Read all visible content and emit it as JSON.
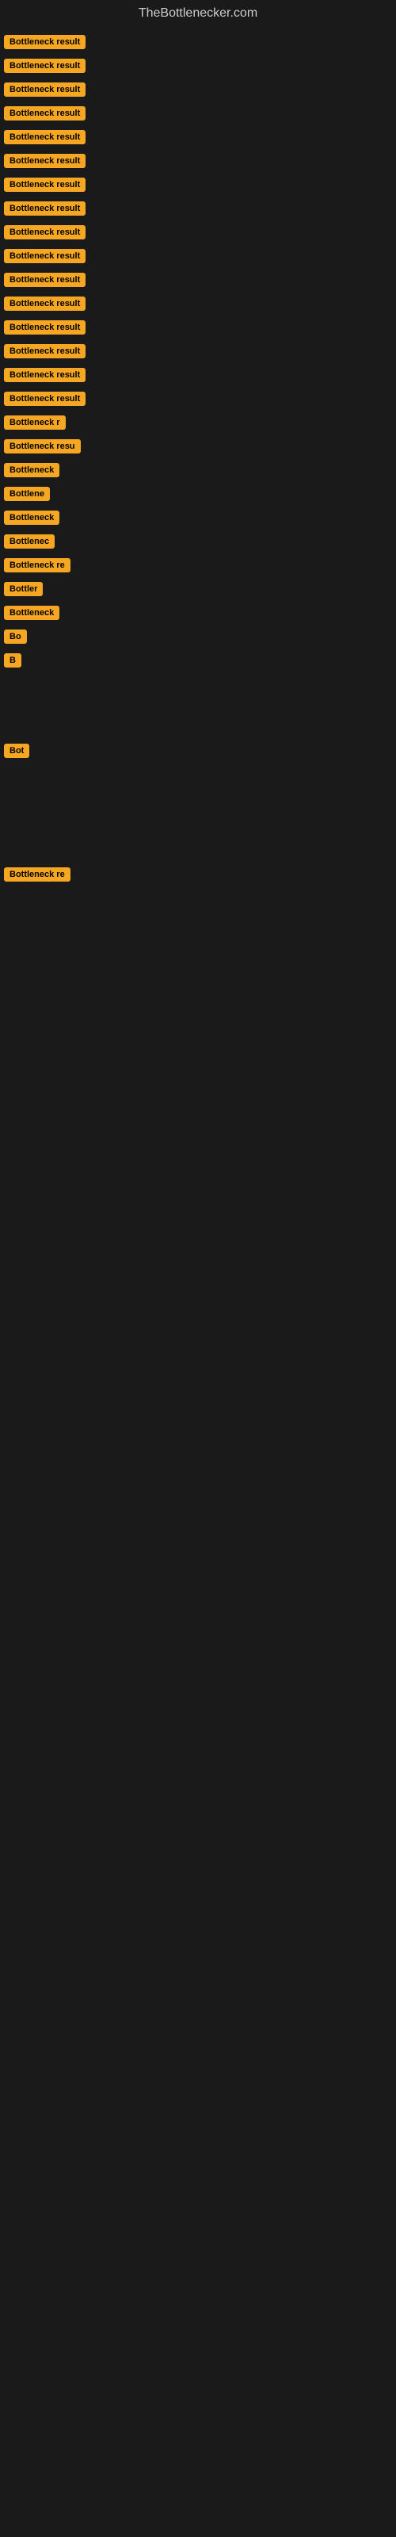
{
  "site": {
    "title": "TheBottlenecker.com"
  },
  "items": [
    {
      "id": 1,
      "label": "Bottleneck result",
      "width": 130
    },
    {
      "id": 2,
      "label": "Bottleneck result",
      "width": 130
    },
    {
      "id": 3,
      "label": "Bottleneck result",
      "width": 130
    },
    {
      "id": 4,
      "label": "Bottleneck result",
      "width": 130
    },
    {
      "id": 5,
      "label": "Bottleneck result",
      "width": 130
    },
    {
      "id": 6,
      "label": "Bottleneck result",
      "width": 130
    },
    {
      "id": 7,
      "label": "Bottleneck result",
      "width": 130
    },
    {
      "id": 8,
      "label": "Bottleneck result",
      "width": 130
    },
    {
      "id": 9,
      "label": "Bottleneck result",
      "width": 130
    },
    {
      "id": 10,
      "label": "Bottleneck result",
      "width": 130
    },
    {
      "id": 11,
      "label": "Bottleneck result",
      "width": 130
    },
    {
      "id": 12,
      "label": "Bottleneck result",
      "width": 130
    },
    {
      "id": 13,
      "label": "Bottleneck result",
      "width": 130
    },
    {
      "id": 14,
      "label": "Bottleneck result",
      "width": 130
    },
    {
      "id": 15,
      "label": "Bottleneck result",
      "width": 130
    },
    {
      "id": 16,
      "label": "Bottleneck result",
      "width": 125
    },
    {
      "id": 17,
      "label": "Bottleneck r",
      "width": 90
    },
    {
      "id": 18,
      "label": "Bottleneck resu",
      "width": 110
    },
    {
      "id": 19,
      "label": "Bottleneck",
      "width": 78
    },
    {
      "id": 20,
      "label": "Bottlene",
      "width": 65
    },
    {
      "id": 21,
      "label": "Bottleneck",
      "width": 78
    },
    {
      "id": 22,
      "label": "Bottlenec",
      "width": 72
    },
    {
      "id": 23,
      "label": "Bottleneck re",
      "width": 100
    },
    {
      "id": 24,
      "label": "Bottler",
      "width": 55
    },
    {
      "id": 25,
      "label": "Bottleneck",
      "width": 78
    },
    {
      "id": 26,
      "label": "Bo",
      "width": 28
    },
    {
      "id": 27,
      "label": "B",
      "width": 14
    },
    {
      "id": 28,
      "label": "",
      "width": 0
    },
    {
      "id": 29,
      "label": "",
      "width": 0
    },
    {
      "id": 30,
      "label": "Bot",
      "width": 30
    },
    {
      "id": 31,
      "label": "",
      "width": 0
    },
    {
      "id": 32,
      "label": "",
      "width": 0
    },
    {
      "id": 33,
      "label": "",
      "width": 0
    },
    {
      "id": 34,
      "label": "Bottleneck re",
      "width": 100
    },
    {
      "id": 35,
      "label": "",
      "width": 0
    },
    {
      "id": 36,
      "label": "",
      "width": 0
    }
  ]
}
